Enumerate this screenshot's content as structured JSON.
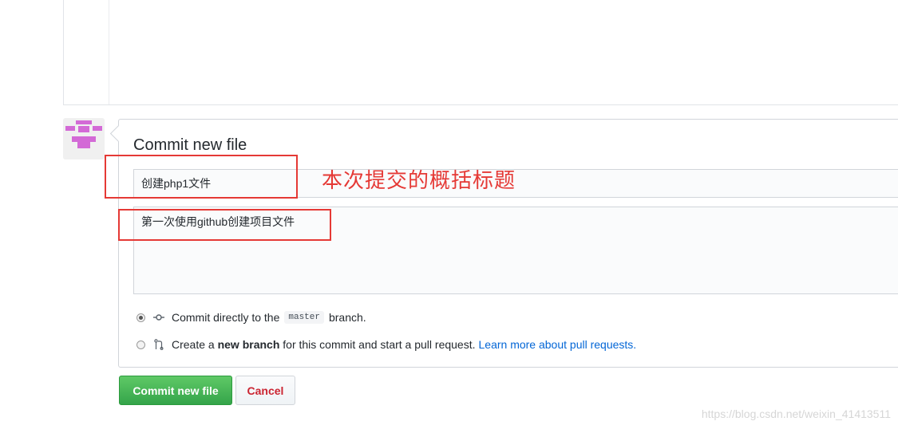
{
  "commit_form": {
    "title": "Commit new file",
    "summary_value": "创建php1文件",
    "description_value": "第一次使用github创建项目文件",
    "option_direct": {
      "text_before": "Commit directly to the",
      "branch": "master",
      "text_after": "branch.",
      "selected": true
    },
    "option_new_branch": {
      "text_before": "Create a",
      "bold": "new branch",
      "text_after": "for this commit and start a pull request.",
      "link": "Learn more about pull requests.",
      "selected": false
    }
  },
  "buttons": {
    "commit": "Commit new file",
    "cancel": "Cancel"
  },
  "annotation": {
    "text": "本次提交的概括标题",
    "color": "#e53935"
  },
  "watermark": "https://blog.csdn.net/weixin_41413511",
  "colors": {
    "commit_button": "#34a44a",
    "cancel_text": "#cb2431",
    "link": "#0366d6",
    "avatar": "#d36ad6"
  },
  "icons": {
    "commit": "git-commit-icon",
    "pull_request": "git-pull-request-icon"
  }
}
